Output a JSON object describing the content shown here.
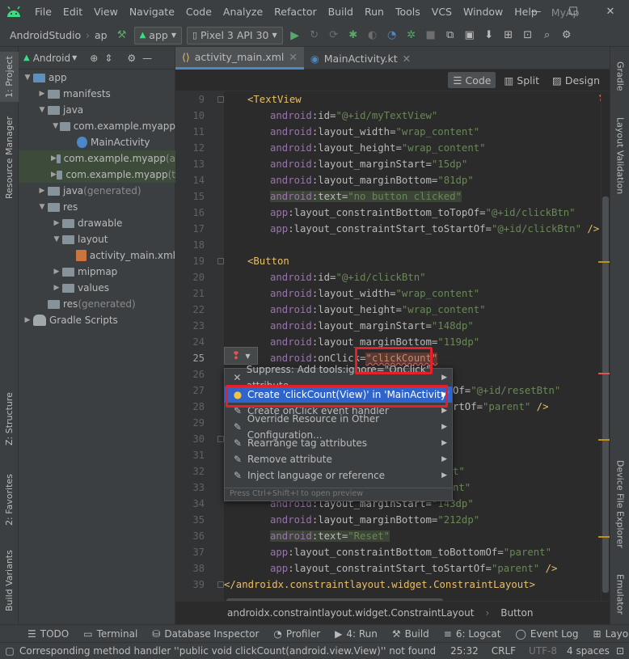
{
  "titlebar": {
    "menu": [
      "File",
      "Edit",
      "View",
      "Navigate",
      "Code",
      "Analyze",
      "Refactor",
      "Build",
      "Run",
      "Tools",
      "VCS",
      "Window",
      "Help"
    ],
    "project_name": "MyAp",
    "min": "—",
    "max": "☐",
    "close": "✕"
  },
  "toolbar": {
    "crumb1": "AndroidStudio",
    "crumb2": "ap",
    "config": "app",
    "device": "Pixel 3 API 30"
  },
  "project_panel": {
    "view_label": "Android",
    "rows": [
      {
        "label": "app",
        "indent": 1,
        "tri": "▼",
        "icon": "folder-blue"
      },
      {
        "label": "manifests",
        "indent": 2,
        "tri": "▶",
        "icon": "folder"
      },
      {
        "label": "java",
        "indent": 2,
        "tri": "▼",
        "icon": "folder"
      },
      {
        "label": "com.example.myapp",
        "indent": 3,
        "tri": "▼",
        "icon": "folder"
      },
      {
        "label": "MainActivity",
        "indent": 4,
        "tri": "",
        "icon": "kotlin-class"
      },
      {
        "label": "com.example.myapp",
        "suffix": " (a",
        "indent": 3,
        "tri": "▶",
        "icon": "folder",
        "hl": true
      },
      {
        "label": "com.example.myapp",
        "suffix": " (t",
        "indent": 3,
        "tri": "▶",
        "icon": "folder",
        "hl": true
      },
      {
        "label": "java",
        "suffix": " (generated)",
        "indent": 2,
        "tri": "▶",
        "icon": "folder"
      },
      {
        "label": "res",
        "indent": 2,
        "tri": "▼",
        "icon": "folder"
      },
      {
        "label": "drawable",
        "indent": 3,
        "tri": "▶",
        "icon": "folder"
      },
      {
        "label": "layout",
        "indent": 3,
        "tri": "▼",
        "icon": "folder"
      },
      {
        "label": "activity_main.xml",
        "indent": 4,
        "tri": "",
        "icon": "xml"
      },
      {
        "label": "mipmap",
        "indent": 3,
        "tri": "▶",
        "icon": "folder"
      },
      {
        "label": "values",
        "indent": 3,
        "tri": "▶",
        "icon": "folder"
      },
      {
        "label": "res",
        "suffix": " (generated)",
        "indent": 2,
        "tri": "",
        "icon": "folder"
      },
      {
        "label": "Gradle Scripts",
        "indent": 1,
        "tri": "▶",
        "icon": "gradle"
      }
    ]
  },
  "tabs": [
    {
      "label": "activity_main.xml",
      "active": true
    },
    {
      "label": "MainActivity.kt",
      "active": false
    }
  ],
  "modes": [
    "Code",
    "Split",
    "Design"
  ],
  "left_tools": [
    "1: Project",
    "Resource Manager",
    "Z: Structure",
    "2: Favorites",
    "Build Variants"
  ],
  "right_tools": [
    "Gradle",
    "Layout Validation",
    "Device File Explorer",
    "Emulator"
  ],
  "line_numbers": [
    "9",
    "10",
    "11",
    "12",
    "13",
    "14",
    "15",
    "16",
    "17",
    "18",
    "19",
    "20",
    "21",
    "22",
    "23",
    "24",
    "25",
    "26",
    "27",
    "28",
    "29",
    "30",
    "31",
    "32",
    "33",
    "34",
    "35",
    "36",
    "37",
    "38",
    "39"
  ],
  "code": {
    "l9": "<TextView",
    "l10": [
      "android",
      ":id=",
      "\"@+id/myTextView\""
    ],
    "l11": [
      "android",
      ":layout_width=",
      "\"wrap_content\""
    ],
    "l12": [
      "android",
      ":layout_height=",
      "\"wrap_content\""
    ],
    "l13": [
      "android",
      ":layout_marginStart=",
      "\"15dp\""
    ],
    "l14": [
      "android",
      ":layout_marginBottom=",
      "\"81dp\""
    ],
    "l15": [
      "android",
      ":text=",
      "\"no button clicked\""
    ],
    "l16": [
      "app",
      ":layout_constraintBottom_toTopOf=",
      "\"@+id/clickBtn\""
    ],
    "l17": [
      "app",
      ":layout_constraintStart_toStartOf=",
      "\"@+id/clickBtn\"",
      " />"
    ],
    "l19": "<Button",
    "l20": [
      "android",
      ":id=",
      "\"@+id/clickBtn\""
    ],
    "l21": [
      "android",
      ":layout_width=",
      "\"wrap_content\""
    ],
    "l22": [
      "android",
      ":layout_height=",
      "\"wrap_content\""
    ],
    "l23": [
      "android",
      ":layout_marginStart=",
      "\"148dp\""
    ],
    "l24": [
      "android",
      ":layout_marginBottom=",
      "\"119dp\""
    ],
    "l25": [
      "android",
      ":onClick=",
      "\"clickCount\""
    ],
    "l27": [
      "Of=",
      "\"@+id/resetBtn\""
    ],
    "l28": [
      "rtOf=",
      "\"parent\"",
      " />"
    ],
    "l32": "t\"",
    "l33": "nt\"",
    "l34": [
      "android",
      ":layout_marginStart=",
      "\"143dp\""
    ],
    "l35": [
      "android",
      ":layout_marginBottom=",
      "\"212dp\""
    ],
    "l36": [
      "android",
      ":text=",
      "\"Reset\""
    ],
    "l37": [
      "app",
      ":layout_constraintBottom_toBottomOf=",
      "\"parent\""
    ],
    "l38": [
      "app",
      ":layout_constraintStart_toStartOf=",
      "\"parent\"",
      " />"
    ],
    "l39": "</androidx.constraintlayout.widget.ConstraintLayout>"
  },
  "popup": {
    "items": [
      {
        "label": "Suppress: Add tools:ignore=\"OnClick\" attribute",
        "icon": "✕",
        "arrow": true
      },
      {
        "label": "Create 'clickCount(View)' in 'MainActivity'",
        "icon": "bulb",
        "arrow": true,
        "selected": true
      },
      {
        "label": "Create onClick event handler",
        "icon": "wrench",
        "arrow": true
      },
      {
        "label": "Override Resource in Other Configuration...",
        "icon": "wrench",
        "arrow": true
      },
      {
        "label": "Rearrange tag attributes",
        "icon": "wrench",
        "arrow": true
      },
      {
        "label": "Remove attribute",
        "icon": "wrench",
        "arrow": true
      },
      {
        "label": "Inject language or reference",
        "icon": "wrench",
        "arrow": true
      }
    ],
    "hint": "Press Ctrl+Shift+I to open preview"
  },
  "breadcrumb": [
    "androidx.constraintlayout.widget.ConstraintLayout",
    "Button"
  ],
  "tool_windows": [
    "TODO",
    "Terminal",
    "Database Inspector",
    "Profiler",
    "4: Run",
    "Build",
    "6: Logcat",
    "Event Log",
    "Layout Inspecto"
  ],
  "status": {
    "message": "Corresponding method handler ''public void clickCount(android.view.View)'' not found",
    "position": "25:32",
    "line_sep": "CRLF",
    "encoding": "UTF-8",
    "indent": "4 spaces"
  },
  "colors": {
    "accent": "#2f65ca",
    "highlight_box": "#e5202a",
    "error": "#e05454"
  }
}
